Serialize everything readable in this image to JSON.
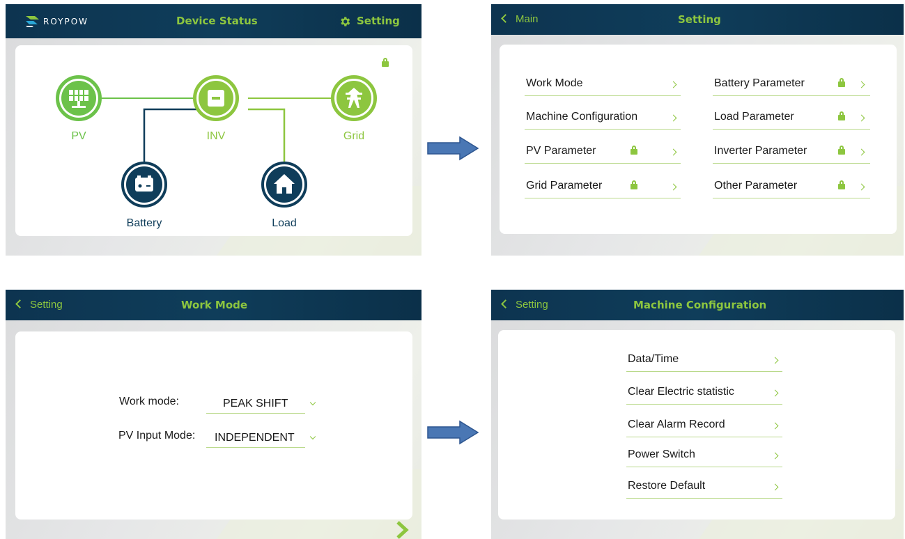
{
  "screen1": {
    "brand": "ROYPOW",
    "title": "Device Status",
    "setting_label": "Setting",
    "nodes": {
      "pv": "PV",
      "inv": "INV",
      "grid": "Grid",
      "battery": "Battery",
      "load": "Load"
    },
    "colors": {
      "green": "#6cc24a",
      "lime": "#8dc63f",
      "navy": "#0f3d5a"
    }
  },
  "screen2": {
    "back_label": "Main",
    "title": "Setting",
    "left_items": [
      {
        "label": "Work Mode",
        "locked": false
      },
      {
        "label": "Machine Configuration",
        "locked": false
      },
      {
        "label": "PV Parameter",
        "locked": true
      },
      {
        "label": "Grid Parameter",
        "locked": true
      }
    ],
    "right_items": [
      {
        "label": "Battery Parameter",
        "locked": true
      },
      {
        "label": "Load Parameter",
        "locked": true
      },
      {
        "label": "Inverter Parameter",
        "locked": true
      },
      {
        "label": "Other Parameter",
        "locked": true
      }
    ]
  },
  "screen3": {
    "back_label": "Setting",
    "title": "Work Mode",
    "work_mode_label": "Work mode:",
    "work_mode_value": "PEAK SHIFT",
    "pv_input_label": "PV Input Mode:",
    "pv_input_value": "INDEPENDENT"
  },
  "screen4": {
    "back_label": "Setting",
    "title": "Machine Configuration",
    "items": [
      "Data/Time",
      "Clear Electric statistic",
      "Clear Alarm Record",
      "Power Switch",
      "Restore Default"
    ]
  }
}
